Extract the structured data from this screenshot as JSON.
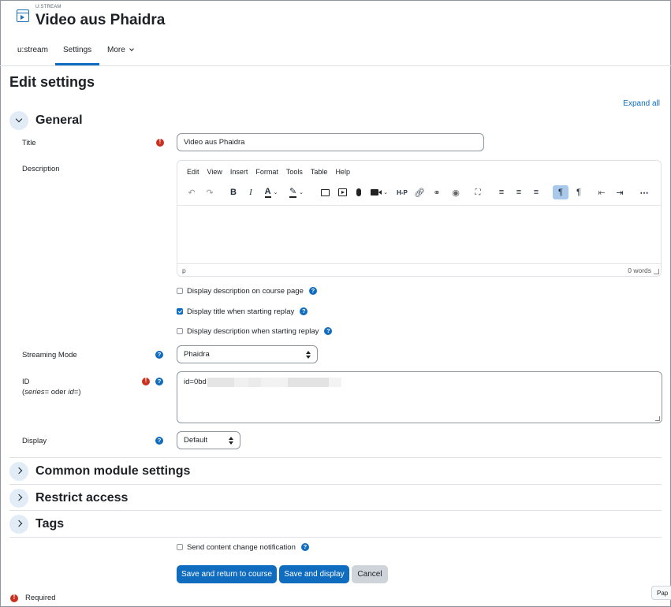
{
  "module": {
    "type_label": "U:STREAM",
    "title": "Video aus Phaidra"
  },
  "nav": {
    "tabs": [
      "u:stream",
      "Settings",
      "More"
    ],
    "active": "Settings"
  },
  "page": {
    "heading": "Edit settings",
    "expand_all": "Expand all"
  },
  "general": {
    "title": "General",
    "title_label": "Title",
    "title_value": "Video aus Phaidra",
    "description_label": "Description",
    "editor": {
      "menu": [
        "Edit",
        "View",
        "Insert",
        "Format",
        "Tools",
        "Table",
        "Help"
      ],
      "status_path": "p",
      "word_count": "0 words"
    },
    "options": [
      {
        "label": "Display description on course page",
        "checked": false
      },
      {
        "label": "Display title when starting replay",
        "checked": true
      },
      {
        "label": "Display description when starting replay",
        "checked": false
      }
    ],
    "streaming_mode_label": "Streaming Mode",
    "streaming_mode_value": "Phaidra",
    "id_label": "ID",
    "id_hint_series": "series=",
    "id_hint_or": " oder ",
    "id_hint_id": "id=",
    "id_value": "id=0bd",
    "display_label": "Display",
    "display_value": "Default"
  },
  "sections": [
    "Common module settings",
    "Restrict access",
    "Tags"
  ],
  "notification_label": "Send content change notification",
  "buttons": {
    "save_return": "Save and return to course",
    "save_display": "Save and display",
    "cancel": "Cancel"
  },
  "required_legend": "Required",
  "page_tab": "Pap",
  "colors": {
    "primary": "#0f6cbf",
    "required": "#ca3120",
    "secondary": "#ced4da"
  }
}
